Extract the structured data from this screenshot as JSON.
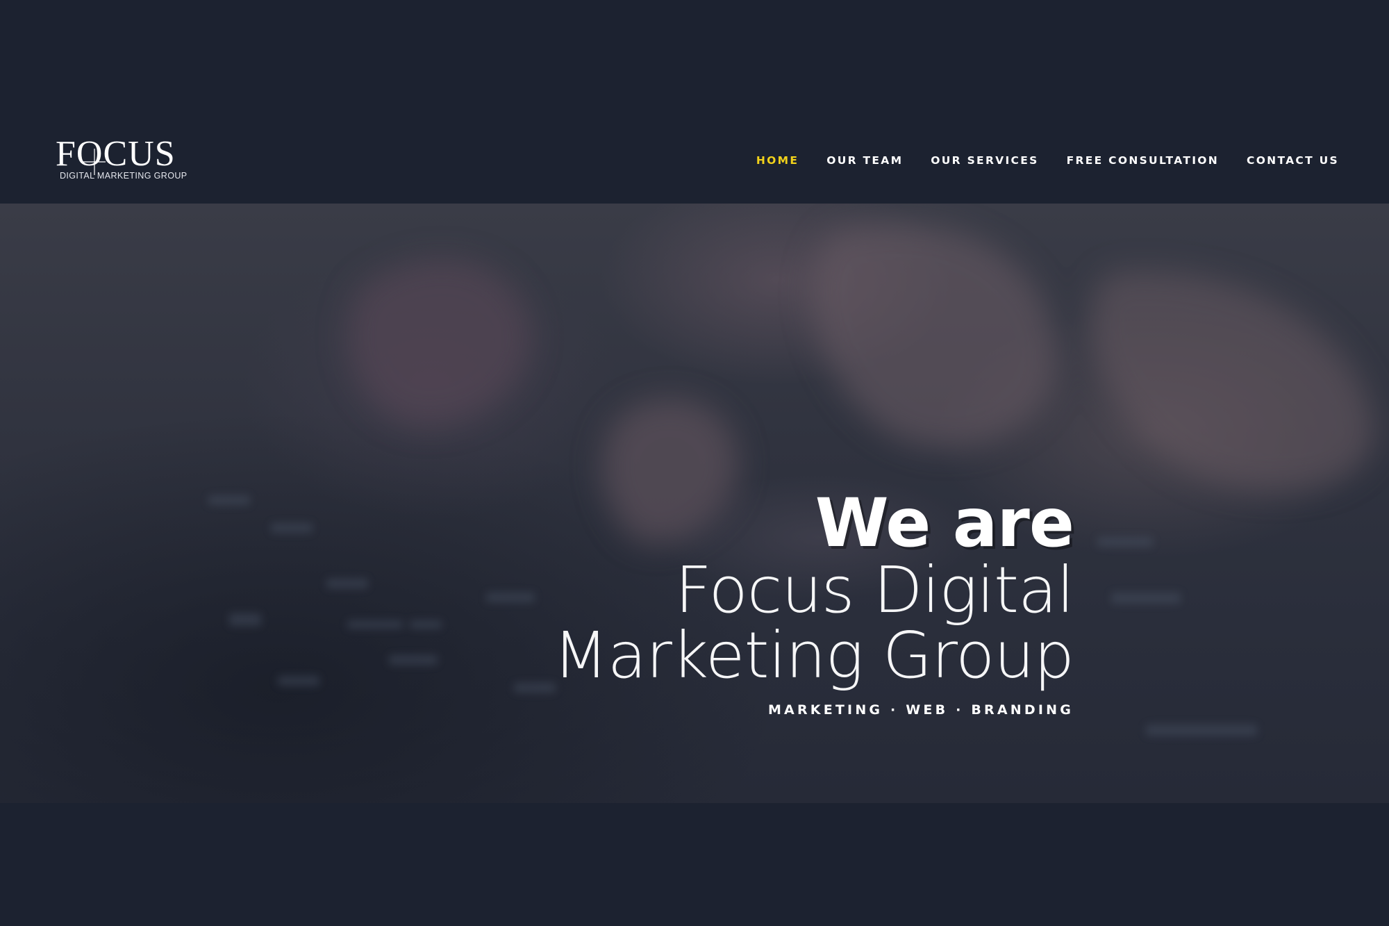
{
  "brand": {
    "logo_word": "FOCUS",
    "logo_tagline": "DIGITAL MARKETING GROUP"
  },
  "nav": {
    "items": [
      {
        "label": "HOME",
        "active": true
      },
      {
        "label": "OUR TEAM",
        "active": false
      },
      {
        "label": "OUR SERVICES",
        "active": false
      },
      {
        "label": "FREE CONSULTATION",
        "active": false
      },
      {
        "label": "CONTACT US",
        "active": false
      }
    ],
    "active_color": "#f2d21b"
  },
  "hero": {
    "line1": "We are",
    "line2": "Focus Digital",
    "line3": "Marketing Group",
    "subline": "MARKETING · WEB · BRANDING",
    "background_description_icon": "keyboard-typing-photo"
  },
  "colors": {
    "page_background": "#1c2230",
    "text": "#ffffff",
    "accent": "#f2d21b"
  }
}
